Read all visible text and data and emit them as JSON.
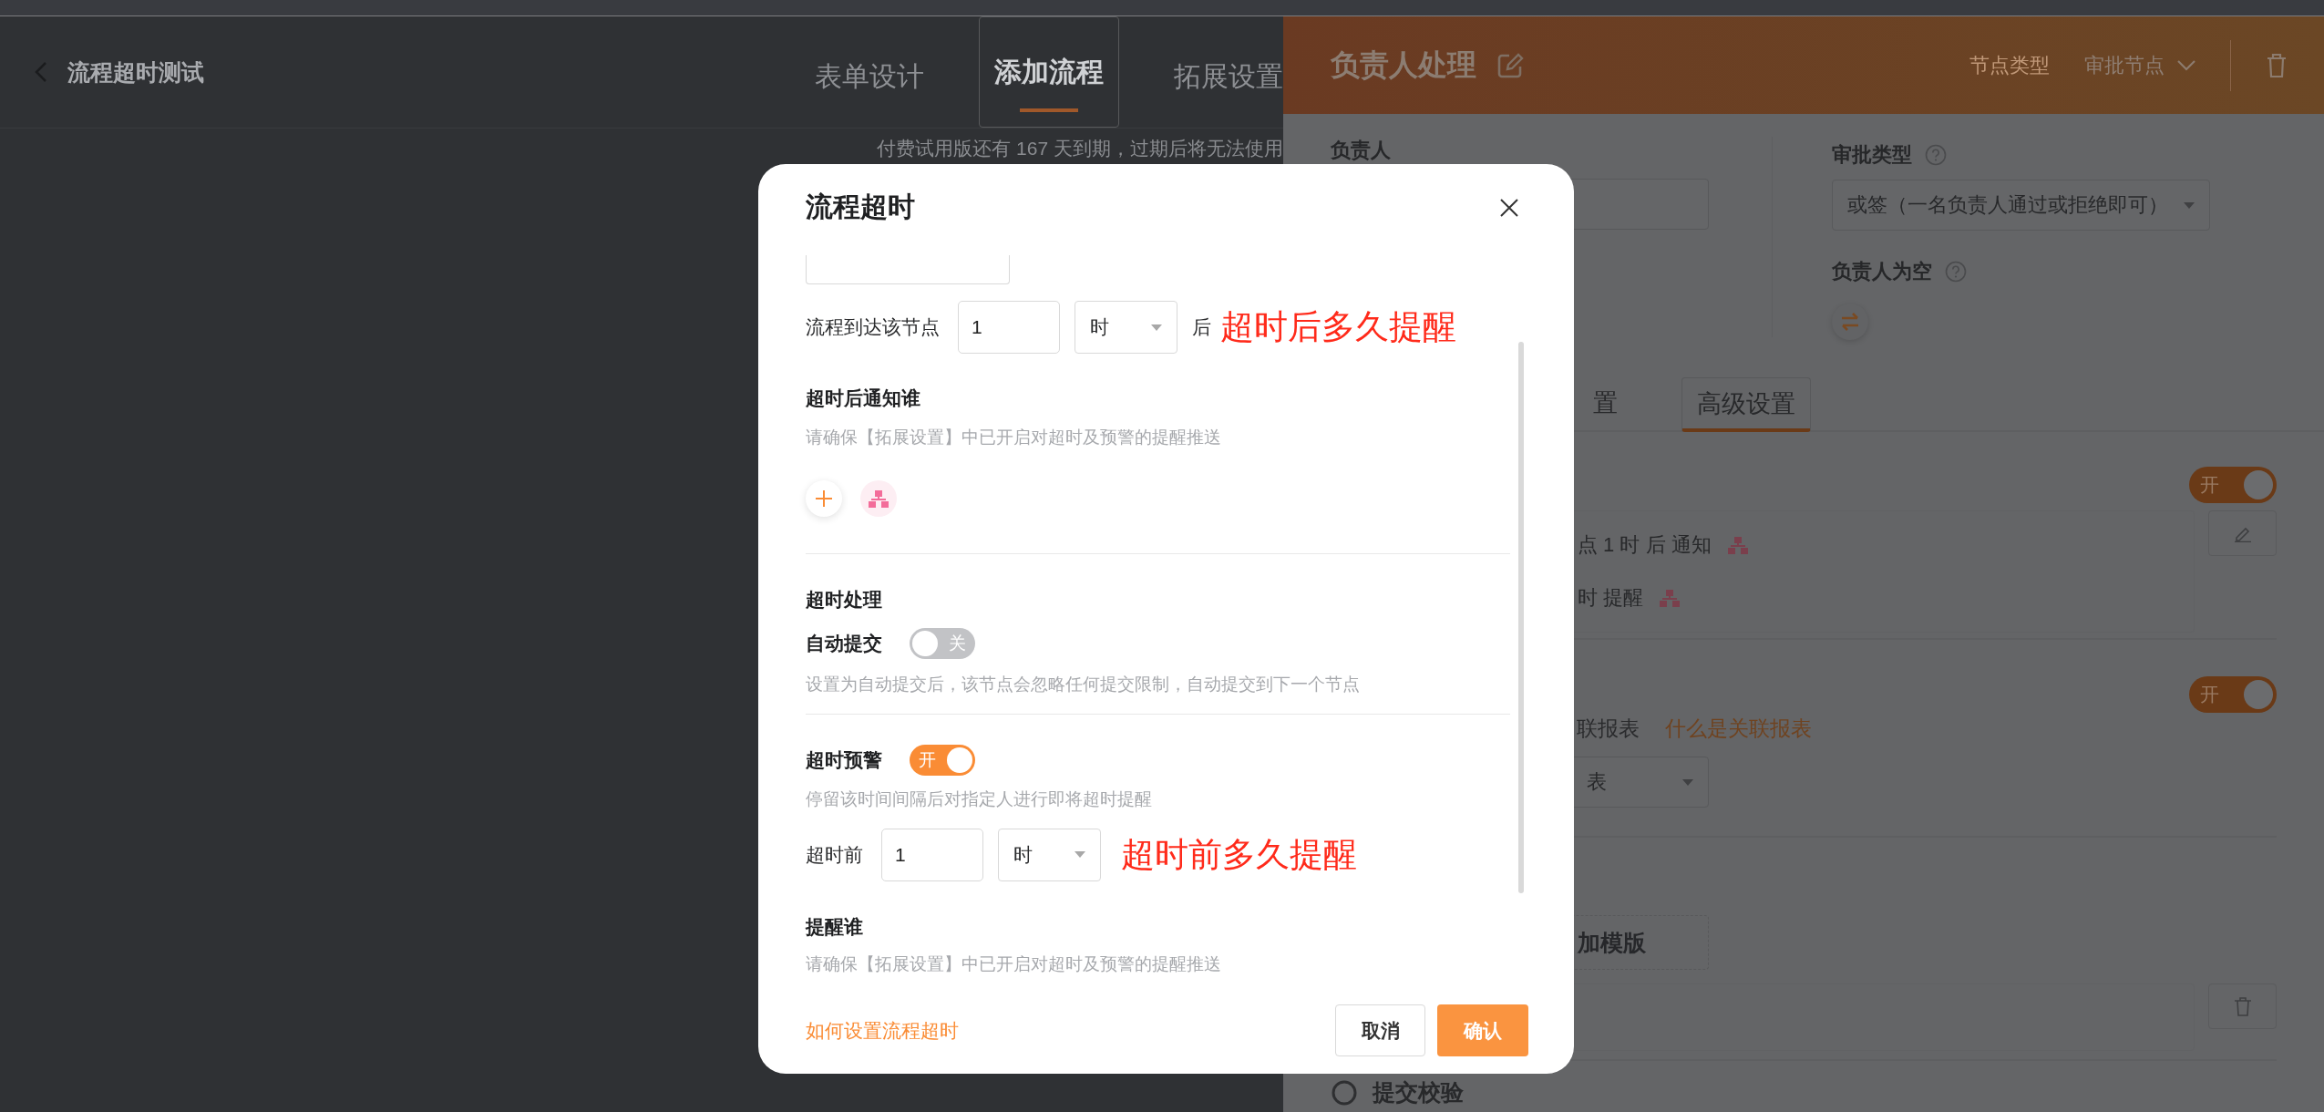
{
  "app_header": {
    "title": "流程超时测试",
    "tabs": [
      {
        "label": "表单设计",
        "selected": false
      },
      {
        "label": "添加流程",
        "selected": true
      },
      {
        "label": "拓展设置",
        "selected": false
      }
    ],
    "notice": "付费试用版还有 167 天到期，过期后将无法使用"
  },
  "node_panel": {
    "title": "负责人处理",
    "node_type_label": "节点类型",
    "node_type": "审批节点",
    "assignee_label": "负责人",
    "approval_type_label": "审批类型",
    "approval_type": "或签（一名负责人通过或拒绝即可）",
    "empty_assignee_label": "负责人为空",
    "tabs": [
      {
        "label": "置",
        "selected": false
      },
      {
        "label": "高级设置",
        "selected": true
      }
    ],
    "timeout_section": {
      "on": true,
      "state_text": "开",
      "rows": [
        "点 1 时 后 通知",
        "时 提醒"
      ]
    },
    "report_section": {
      "on": true,
      "state_text": "开",
      "label": "联报表",
      "link": "什么是关联报表",
      "select_value": "表"
    },
    "template_section": {
      "add_button": "加模版"
    },
    "validation_section": {
      "title": "提交校验"
    }
  },
  "dialog": {
    "title": "流程超时",
    "arrival": {
      "label": "流程到达该节点",
      "amount": "1",
      "unit": "时",
      "suffix": "后",
      "annotation": "超时后多久提醒"
    },
    "notify": {
      "title": "超时后通知谁",
      "hint": "请确保【拓展设置】中已开启对超时及预警的提醒推送"
    },
    "handling": {
      "title": "超时处理",
      "toggle_label": "自动提交",
      "on": false,
      "state_text": "关",
      "hint": "设置为自动提交后，该节点会忽略任何提交限制，自动提交到下一个节点"
    },
    "warning": {
      "title": "超时预警",
      "on": true,
      "state_text": "开",
      "hint": "停留该时间间隔后对指定人进行即将超时提醒",
      "before_label": "超时前",
      "amount": "1",
      "unit": "时",
      "annotation": "超时前多久提醒"
    },
    "remind": {
      "title": "提醒谁",
      "hint": "请确保【拓展设置】中已开启对超时及预警的提醒推送"
    },
    "help_link": "如何设置流程超时",
    "buttons": [
      {
        "label": "取消",
        "kind": "secondary"
      },
      {
        "label": "确认",
        "kind": "primary"
      }
    ]
  }
}
